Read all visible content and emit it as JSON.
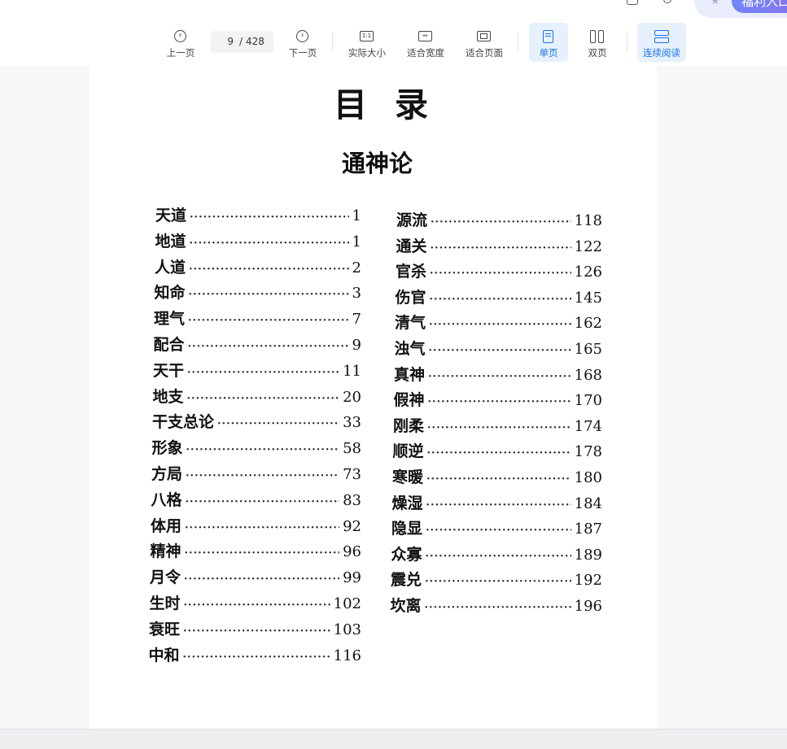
{
  "toolbar": {
    "prev_label": "上一页",
    "next_label": "下一页",
    "page_current": "9",
    "page_separator": "/",
    "page_total": "428",
    "actual_size_label": "实际大小",
    "actual_size_icon_text": "1:1",
    "fit_width_label": "适合宽度",
    "fit_width_icon_text": "↔",
    "fit_page_label": "适合页面",
    "single_page_label": "单页",
    "double_page_label": "双页",
    "continuous_label": "连续阅读",
    "active_color": "#1a73e8"
  },
  "promo": {
    "label": "福利入口"
  },
  "document": {
    "title": "目录",
    "subtitle": "通神论",
    "left_column": [
      {
        "name": "天道",
        "page": "1"
      },
      {
        "name": "地道",
        "page": "1"
      },
      {
        "name": "人道",
        "page": "2"
      },
      {
        "name": "知命",
        "page": "3"
      },
      {
        "name": "理气",
        "page": "7"
      },
      {
        "name": "配合",
        "page": "9"
      },
      {
        "name": "天干",
        "page": "11"
      },
      {
        "name": "地支",
        "page": "20"
      },
      {
        "name": "干支总论",
        "page": "33"
      },
      {
        "name": "形象",
        "page": "58"
      },
      {
        "name": "方局",
        "page": "73"
      },
      {
        "name": "八格",
        "page": "83"
      },
      {
        "name": "体用",
        "page": "92"
      },
      {
        "name": "精神",
        "page": "96"
      },
      {
        "name": "月令",
        "page": "99"
      },
      {
        "name": "生时",
        "page": "102"
      },
      {
        "name": "衰旺",
        "page": "103"
      },
      {
        "name": "中和",
        "page": "116"
      }
    ],
    "right_column": [
      {
        "name": "源流",
        "page": "118"
      },
      {
        "name": "通关",
        "page": "122"
      },
      {
        "name": "官杀",
        "page": "126"
      },
      {
        "name": "伤官",
        "page": "145"
      },
      {
        "name": "清气",
        "page": "162"
      },
      {
        "name": "浊气",
        "page": "165"
      },
      {
        "name": "真神",
        "page": "168"
      },
      {
        "name": "假神",
        "page": "170"
      },
      {
        "name": "刚柔",
        "page": "174"
      },
      {
        "name": "顺逆",
        "page": "178"
      },
      {
        "name": "寒暖",
        "page": "180"
      },
      {
        "name": "燥湿",
        "page": "184"
      },
      {
        "name": "隐显",
        "page": "187"
      },
      {
        "name": "众寡",
        "page": "189"
      },
      {
        "name": "震兑",
        "page": "192"
      },
      {
        "name": "坎离",
        "page": "196"
      }
    ]
  }
}
